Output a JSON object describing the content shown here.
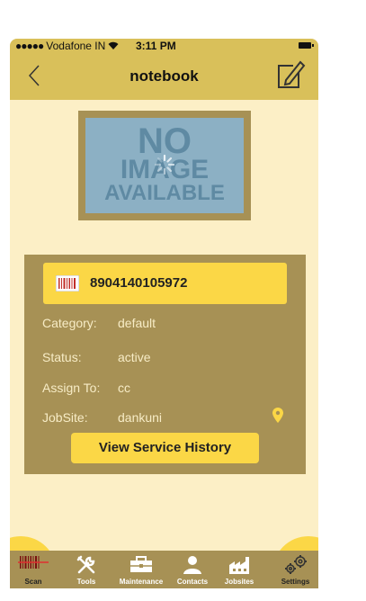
{
  "status_bar": {
    "carrier": "Vodafone IN",
    "time": "3:11 PM"
  },
  "nav": {
    "title": "notebook"
  },
  "placeholder_image": {
    "line1": "NO",
    "line2": "IMAGE",
    "line3": "AVAILABLE"
  },
  "item": {
    "barcode": "8904140105972",
    "fields": [
      {
        "label": "Category:",
        "value": "default"
      },
      {
        "label": "Status:",
        "value": "active"
      },
      {
        "label": "Assign To:",
        "value": "cc"
      },
      {
        "label": "JobSite:",
        "value": "dankuni"
      }
    ],
    "history_button": "View Service History"
  },
  "tabs": [
    "Scan",
    "Tools",
    "Maintenance",
    "Contacts",
    "Jobsites",
    "Settings"
  ],
  "colors": {
    "accent": "#fbd746",
    "bar": "#d9c05a",
    "card": "#a79155",
    "background": "#fcefc6"
  }
}
